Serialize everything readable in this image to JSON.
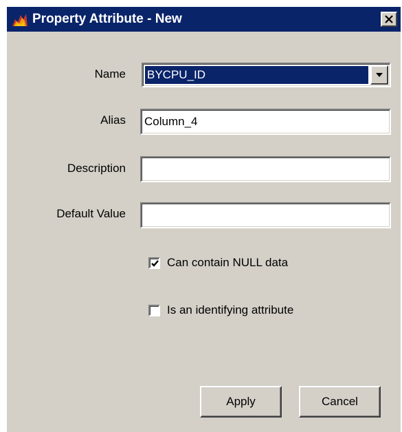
{
  "window": {
    "title": "Property Attribute - New",
    "icon": "app-icon",
    "close_icon": "close-icon",
    "titlebar_color": "#0a246a",
    "background_color": "#d4d0c8"
  },
  "form": {
    "name": {
      "label": "Name",
      "value": "BYCPU_ID"
    },
    "alias": {
      "label": "Alias",
      "value": "Column_4"
    },
    "description": {
      "label": "Description",
      "value": ""
    },
    "default_value": {
      "label": "Default Value",
      "value": ""
    },
    "can_contain_null": {
      "label": "Can contain NULL data",
      "checked": true
    },
    "is_identifying": {
      "label": "Is an identifying attribute",
      "checked": false
    }
  },
  "buttons": {
    "apply": "Apply",
    "cancel": "Cancel"
  }
}
